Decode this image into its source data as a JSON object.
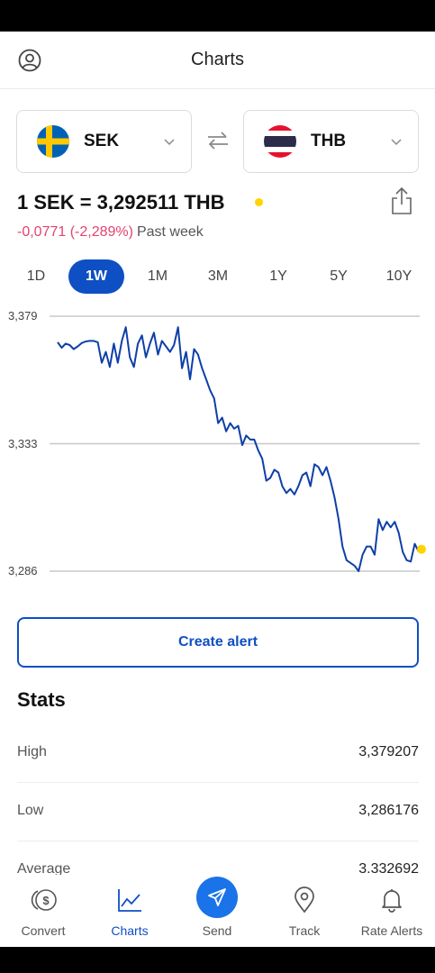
{
  "header": {
    "title": "Charts",
    "profile_icon": "user-circle-icon"
  },
  "from_currency": {
    "code": "SEK",
    "flag": "sweden-flag-icon"
  },
  "to_currency": {
    "code": "THB",
    "flag": "thailand-flag-icon"
  },
  "swap_icon": "swap-arrows-icon",
  "rate": {
    "text": "1 SEK = 3,292511 THB",
    "change": "-0,0771 (-2,289%)",
    "period": "Past week"
  },
  "ranges": [
    {
      "label": "1D",
      "active": false
    },
    {
      "label": "1W",
      "active": true
    },
    {
      "label": "1M",
      "active": false
    },
    {
      "label": "3M",
      "active": false
    },
    {
      "label": "1Y",
      "active": false
    },
    {
      "label": "5Y",
      "active": false
    },
    {
      "label": "10Y",
      "active": false
    }
  ],
  "chart_data": {
    "type": "line",
    "title": "",
    "xlabel": "",
    "ylabel": "",
    "ylim": [
      3.286,
      3.379
    ],
    "y_ticks": [
      "3,379",
      "3,333",
      "3,286"
    ],
    "grid": true,
    "series": [
      {
        "values": [
          3.3695,
          3.3675,
          3.369,
          3.3685,
          3.367,
          3.368,
          3.3692,
          3.3698,
          3.37,
          3.37,
          3.3695,
          3.362,
          3.366,
          3.3605,
          3.369,
          3.362,
          3.37,
          3.375,
          3.364,
          3.3605,
          3.369,
          3.372,
          3.364,
          3.369,
          3.373,
          3.365,
          3.37,
          3.368,
          3.366,
          3.3685,
          3.375,
          3.36,
          3.366,
          3.356,
          3.367,
          3.365,
          3.36,
          3.356,
          3.352,
          3.349,
          3.34,
          3.342,
          3.337,
          3.34,
          3.338,
          3.339,
          3.332,
          3.3355,
          3.334,
          3.334,
          3.33,
          3.327,
          3.319,
          3.32,
          3.323,
          3.322,
          3.317,
          3.3145,
          3.316,
          3.314,
          3.317,
          3.321,
          3.322,
          3.317,
          3.325,
          3.324,
          3.321,
          3.324,
          3.319,
          3.313,
          3.305,
          3.295,
          3.29,
          3.289,
          3.288,
          3.286,
          3.292,
          3.295,
          3.295,
          3.292,
          3.305,
          3.301,
          3.304,
          3.302,
          3.304,
          3.3,
          3.293,
          3.29,
          3.2895,
          3.296,
          3.293
        ]
      }
    ],
    "current_point_color": "#ffd400",
    "line_color": "#0e3fa8"
  },
  "alert": {
    "label": "Create alert"
  },
  "stats": {
    "title": "Stats",
    "rows": [
      {
        "label": "High",
        "value": "3,379207"
      },
      {
        "label": "Low",
        "value": "3,286176"
      },
      {
        "label": "Average",
        "value": "3.332692"
      }
    ]
  },
  "nav": [
    {
      "label": "Convert",
      "icon": "currency-coins-icon",
      "active": false
    },
    {
      "label": "Charts",
      "icon": "line-chart-icon",
      "active": true
    },
    {
      "label": "Send",
      "icon": "paper-plane-icon",
      "active": false
    },
    {
      "label": "Track",
      "icon": "location-pin-icon",
      "active": false
    },
    {
      "label": "Rate Alerts",
      "icon": "bell-icon",
      "active": false
    }
  ],
  "colors": {
    "accent": "#0e4fc4",
    "negative": "#e5426e",
    "live": "#ffd400"
  }
}
